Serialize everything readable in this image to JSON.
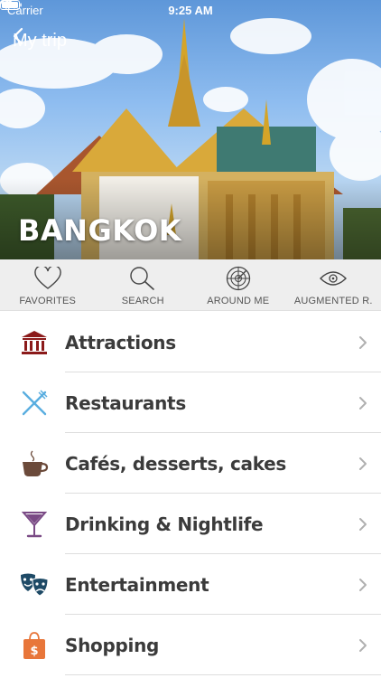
{
  "status_bar": {
    "carrier": "Carrier",
    "time": "9:25 AM"
  },
  "header": {
    "back_label": "My trip",
    "city": "BANGKOK"
  },
  "toolbar": {
    "items": [
      {
        "label": "FAVORITES",
        "icon": "heart-icon"
      },
      {
        "label": "SEARCH",
        "icon": "magnifier-icon"
      },
      {
        "label": "AROUND ME",
        "icon": "radar-icon"
      },
      {
        "label": "AUGMENTED R.",
        "icon": "eye-icon"
      }
    ]
  },
  "categories": [
    {
      "label": "Attractions",
      "icon": "museum-icon",
      "color": "#8b1a1a"
    },
    {
      "label": "Restaurants",
      "icon": "fork-knife-icon",
      "color": "#5aaee0"
    },
    {
      "label": "Cafés, desserts, cakes",
      "icon": "coffee-cup-icon",
      "color": "#6b4a3a"
    },
    {
      "label": "Drinking & Nightlife",
      "icon": "cocktail-icon",
      "color": "#7a4a85"
    },
    {
      "label": "Entertainment",
      "icon": "theater-masks-icon",
      "color": "#1e4a66"
    },
    {
      "label": "Shopping",
      "icon": "shopping-bag-icon",
      "color": "#e8763a"
    }
  ]
}
